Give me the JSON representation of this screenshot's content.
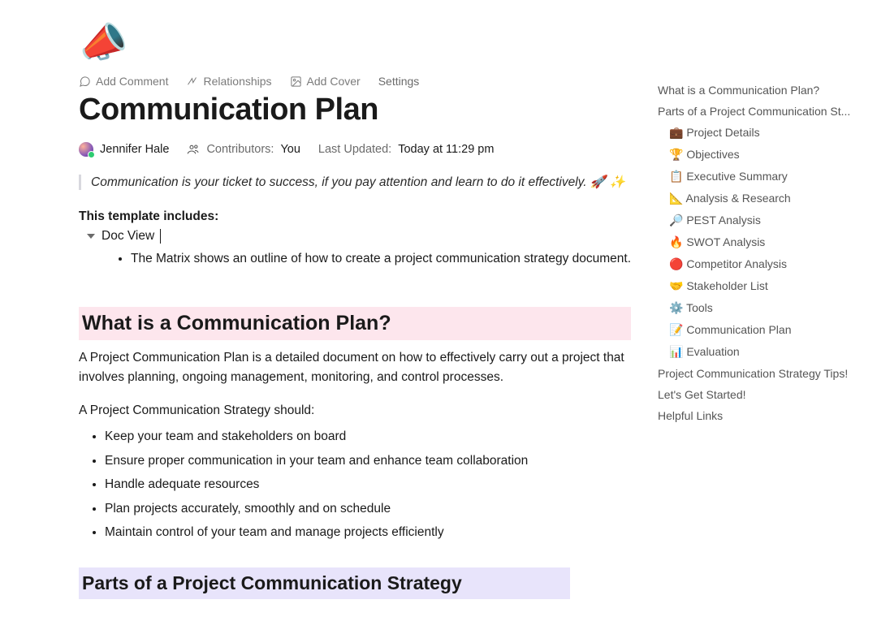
{
  "header": {
    "emoji": "📣",
    "toolbar": {
      "add_comment": "Add Comment",
      "relationships": "Relationships",
      "add_cover": "Add Cover",
      "settings": "Settings"
    },
    "title": "Communication Plan"
  },
  "meta": {
    "author": "Jennifer Hale",
    "contributors_label": "Contributors:",
    "contributors_value": "You",
    "updated_label": "Last Updated:",
    "updated_value": "Today at 11:29 pm"
  },
  "quote": "Communication is your ticket to success, if you pay attention and learn to do it effectively. 🚀 ✨",
  "template_includes_label": "This template includes:",
  "toggle_label": "Doc View",
  "toggle_bullet": "The Matrix shows an outline of how to create a project communication strategy document.",
  "section1": {
    "heading": "What is a Communication Plan?",
    "p1": "A Project Communication Plan is a detailed document on how to effectively carry out a project that involves planning, ongoing management, monitoring, and control processes.",
    "p2": "A Project Communication Strategy should:",
    "bullets": [
      "Keep your team and stakeholders on board",
      "Ensure proper communication in your team and enhance team collaboration",
      "Handle adequate resources",
      "Plan projects accurately, smoothly and on schedule",
      "Maintain control of your team and manage projects efficiently"
    ]
  },
  "section2": {
    "heading": "Parts of a Project Communication Strategy"
  },
  "outline": {
    "items": [
      {
        "label": "What is a Communication Plan?",
        "sub": false
      },
      {
        "label": "Parts of a Project Communication St...",
        "sub": false
      },
      {
        "label": "💼 Project Details",
        "sub": true
      },
      {
        "label": "🏆 Objectives",
        "sub": true
      },
      {
        "label": "📋 Executive Summary",
        "sub": true
      },
      {
        "label": "📐 Analysis & Research",
        "sub": true
      },
      {
        "label": "🔎 PEST Analysis",
        "sub": true
      },
      {
        "label": "🔥 SWOT Analysis",
        "sub": true
      },
      {
        "label": "🔴 Competitor Analysis",
        "sub": true
      },
      {
        "label": "🤝 Stakeholder List",
        "sub": true
      },
      {
        "label": "⚙️ Tools",
        "sub": true
      },
      {
        "label": "📝 Communication Plan",
        "sub": true
      },
      {
        "label": "📊 Evaluation",
        "sub": true
      },
      {
        "label": "Project Communication Strategy Tips!",
        "sub": false
      },
      {
        "label": "Let's Get Started!",
        "sub": false
      },
      {
        "label": "Helpful Links",
        "sub": false
      }
    ]
  }
}
